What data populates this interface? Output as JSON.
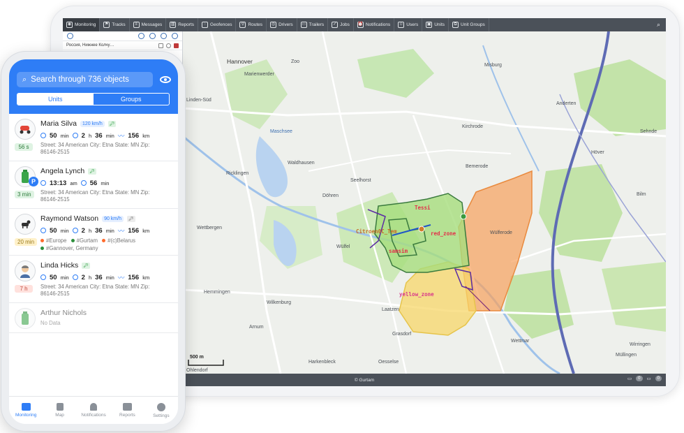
{
  "tablet": {
    "topbar": [
      {
        "label": "Monitoring",
        "icon": "globe-icon"
      },
      {
        "label": "Tracks",
        "icon": "flag-icon"
      },
      {
        "label": "Messages",
        "icon": "list-icon"
      },
      {
        "label": "Reports",
        "icon": "chart-icon"
      },
      {
        "label": "Geofences",
        "icon": "geofence-icon"
      },
      {
        "label": "Routes",
        "icon": "route-icon"
      },
      {
        "label": "Drivers",
        "icon": "steering-wheel-icon"
      },
      {
        "label": "Trailers",
        "icon": "trailer-icon"
      },
      {
        "label": "Jobs",
        "icon": "clipboard-icon"
      },
      {
        "label": "Notifications",
        "icon": "alarm-icon"
      },
      {
        "label": "Users",
        "icon": "user-icon"
      },
      {
        "label": "Units",
        "icon": "car-icon"
      },
      {
        "label": "Unit Groups",
        "icon": "unit-groups-icon"
      }
    ],
    "panel_unit": "Россия, Нижнее Колчу…",
    "footer": "© Gurtam",
    "footer_badges": [
      "0",
      "0"
    ],
    "map": {
      "places": [
        {
          "name": "Hannover"
        },
        {
          "name": "Marienwerder"
        },
        {
          "name": "Zoo"
        },
        {
          "name": "Misburg"
        },
        {
          "name": "Anderten"
        },
        {
          "name": "Höver"
        },
        {
          "name": "Bilm"
        },
        {
          "name": "Kirchrode"
        },
        {
          "name": "Bemerode"
        },
        {
          "name": "Wülferode"
        },
        {
          "name": "Hemmingen"
        },
        {
          "name": "Wilkenburg"
        },
        {
          "name": "Laatzen"
        },
        {
          "name": "Grasdorf"
        },
        {
          "name": "Arnum"
        },
        {
          "name": "Harkenbleck"
        },
        {
          "name": "Ohlendorf"
        },
        {
          "name": "Wettmar"
        },
        {
          "name": "Wirringen"
        },
        {
          "name": "Müllingen"
        },
        {
          "name": "Sehnde"
        },
        {
          "name": "Wettbergen"
        },
        {
          "name": "Ricklingen"
        },
        {
          "name": "Linden-Süd"
        },
        {
          "name": "Maschsee"
        },
        {
          "name": "Waldhausen"
        },
        {
          "name": "Döhren"
        },
        {
          "name": "Seelhorst"
        },
        {
          "name": "Wülfel"
        },
        {
          "name": "Oesselse"
        }
      ],
      "zones": [
        {
          "name": "Citroen0C_Tem",
          "color": "#d77b33"
        },
        {
          "name": "red_zone",
          "color": "#e3314a"
        },
        {
          "name": "samsim",
          "color": "#e3314a"
        },
        {
          "name": "yellow_zone",
          "color": "#d8388a"
        },
        {
          "name": "Tessi",
          "color": "#e3314a"
        }
      ],
      "scale": "500 m"
    }
  },
  "phone": {
    "search_placeholder": "Search through 736 objects",
    "tabs": [
      "Units",
      "Groups"
    ],
    "units": [
      {
        "name": "Maria Silva",
        "speed": "120 km/h",
        "badge": "56 s",
        "stat1": "50",
        "stat1_unit": "min",
        "stat2_h": "2",
        "stat2_m": "36",
        "stat3": "156",
        "stat3_unit": "km",
        "address": "Street: 34 American City: Etna State: MN Zip: 86146-2515"
      },
      {
        "name": "Angela Lynch",
        "badge": "3 min",
        "stat1": "13:13",
        "stat1_unit": "am",
        "stat2": "56",
        "stat2_unit": "min",
        "address": "Street: 34 American City: Etna State: MN Zip: 86146-2515"
      },
      {
        "name": "Raymond Watson",
        "speed": "90 km/h",
        "badge": "20 min",
        "stat1": "50",
        "stat1_unit": "min",
        "stat2_h": "2",
        "stat2_m": "36",
        "stat3": "156",
        "stat3_unit": "km",
        "tags": [
          {
            "label": "#Europe",
            "color": "#ff6b2c"
          },
          {
            "label": "#Gurtam",
            "color": "#2d8f3c"
          },
          {
            "label": "#(c)Belarus",
            "color": "#ff6b2c"
          },
          {
            "label": "#Gannover, Germany",
            "color": "#2d8f3c"
          }
        ]
      },
      {
        "name": "Linda Hicks",
        "badge": "7 h",
        "stat1": "50",
        "stat1_unit": "min",
        "stat2_h": "2",
        "stat2_m": "36",
        "stat3": "156",
        "stat3_unit": "km",
        "address": "Street: 34 American City: Etna State: MN Zip: 86146-2515"
      },
      {
        "name": "Arthur Nichols",
        "status": "No Data"
      }
    ],
    "nav": [
      {
        "label": "Monitoring",
        "icon": "bus-icon"
      },
      {
        "label": "Map",
        "icon": "map-icon"
      },
      {
        "label": "Notifications",
        "icon": "bell-icon"
      },
      {
        "label": "Reports",
        "icon": "table-icon"
      },
      {
        "label": "Settings",
        "icon": "gear-icon"
      }
    ],
    "units_stat_labels": {
      "h": "h",
      "min": "min"
    }
  },
  "colors": {
    "accent": "#2e7df6",
    "topbar": "#4b5159",
    "green_zone": "#8fd66b",
    "orange_zone": "#f7a05c",
    "yellow_zone": "#f7d76a",
    "badge_green": "#dff3e3",
    "badge_yellow": "#fff1c9",
    "badge_red": "#ffe1dd"
  }
}
